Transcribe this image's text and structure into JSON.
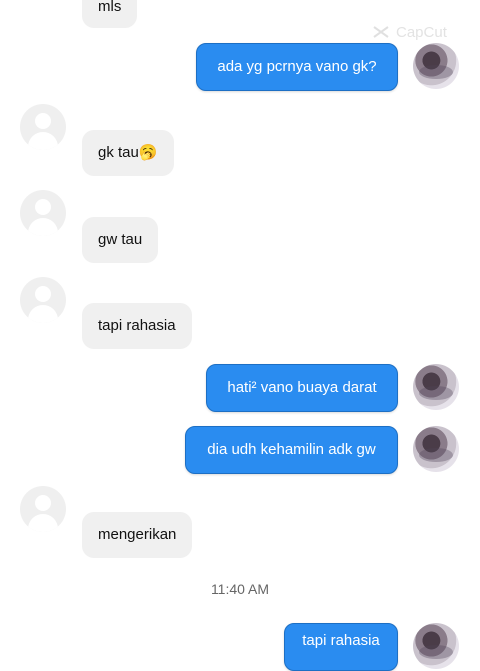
{
  "watermark": {
    "label": "CapCut",
    "icon": "capcut-logo-icon"
  },
  "messages": [
    {
      "side": "in",
      "text": "mls"
    },
    {
      "side": "out",
      "text": "ada yg pcrnya vano gk?"
    },
    {
      "side": "in",
      "text": "gk tau🥱"
    },
    {
      "side": "in",
      "text": "gw tau"
    },
    {
      "side": "in",
      "text": "tapi rahasia"
    },
    {
      "side": "out",
      "text": "hati² vano buaya darat"
    },
    {
      "side": "out",
      "text": "dia udh kehamilin adk gw"
    },
    {
      "side": "in",
      "text": "mengerikan"
    },
    {
      "side": "out",
      "text": "tapi rahasia"
    }
  ],
  "timestamp": "11:40 AM",
  "colors": {
    "outgoing_bubble": "#2a8cf0",
    "incoming_bubble": "#f0f0f0",
    "timestamp_text": "#666666"
  }
}
